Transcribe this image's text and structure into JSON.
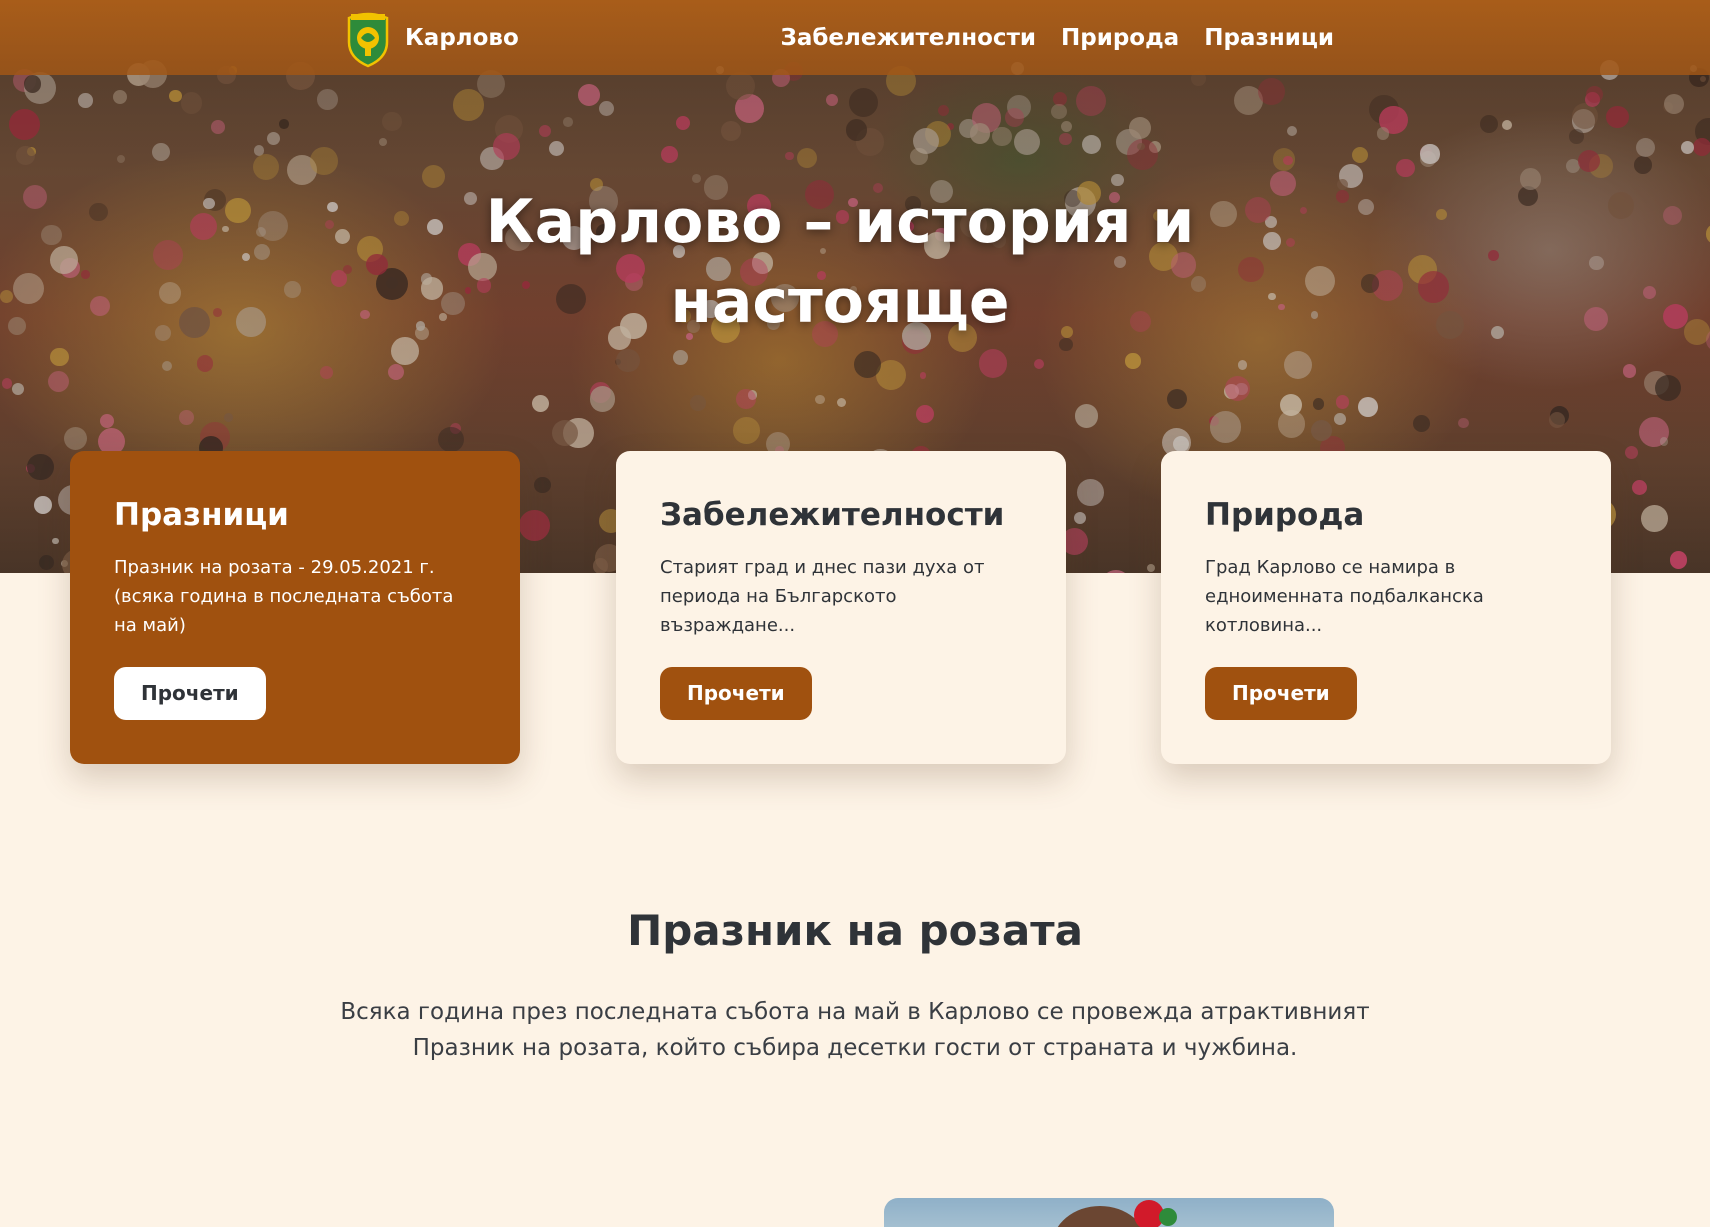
{
  "nav": {
    "brand": "Карлово",
    "links": [
      "Забележителности",
      "Природа",
      "Празници"
    ]
  },
  "hero": {
    "title": "Карлово – история и настояще"
  },
  "cards": [
    {
      "title": "Празници",
      "text": "Празник на розата - 29.05.2021 г. (всяка година в последната събота на май)",
      "button": "Прочети"
    },
    {
      "title": "Забележителности",
      "text": "Старият град и днес пази духа от периода на Българското възраждане...",
      "button": "Прочети"
    },
    {
      "title": "Природа",
      "text": "Град Карлово се намира в едноименната подбалканска котловина...",
      "button": "Прочети"
    }
  ],
  "section": {
    "title": "Празник на розата",
    "text": "Всяка година през последната събота на май в Карлово се провежда атрактивният Празник на розата, който събира десетки гости от страната и чужбина."
  },
  "colors": {
    "accent": "#a0510f",
    "background": "#fdf3e6",
    "text": "#2f3338",
    "nav": "#b06018"
  }
}
